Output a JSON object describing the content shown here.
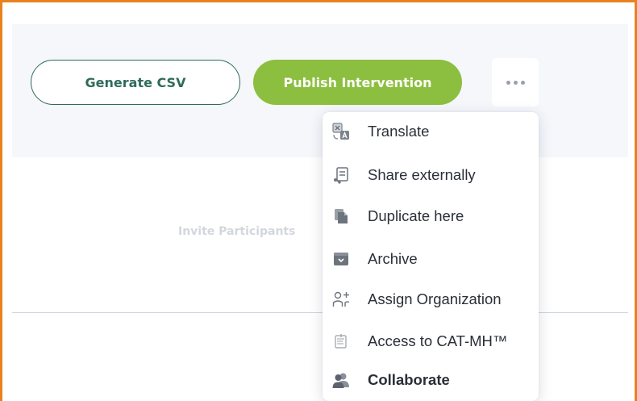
{
  "toolbar": {
    "generate_csv_label": "Generate CSV",
    "publish_label": "Publish Intervention",
    "more_icon": "ellipsis-icon"
  },
  "content": {
    "invite_text": "Invite Participants"
  },
  "menu": {
    "items": [
      {
        "label": "Translate",
        "icon": "translate-icon"
      },
      {
        "label": "Share externally",
        "icon": "share-icon"
      },
      {
        "label": "Duplicate here",
        "icon": "duplicate-icon"
      },
      {
        "label": "Archive",
        "icon": "archive-icon"
      },
      {
        "label": "Assign Organization",
        "icon": "assign-organization-icon"
      },
      {
        "label": "Access to CAT-MH™",
        "icon": "cat-mh-icon"
      },
      {
        "label": "Collaborate",
        "icon": "collaborate-icon"
      }
    ]
  },
  "colors": {
    "accent_green": "#8cbf3f",
    "dark_green": "#2e6b5a",
    "frame_orange": "#e8821e"
  }
}
